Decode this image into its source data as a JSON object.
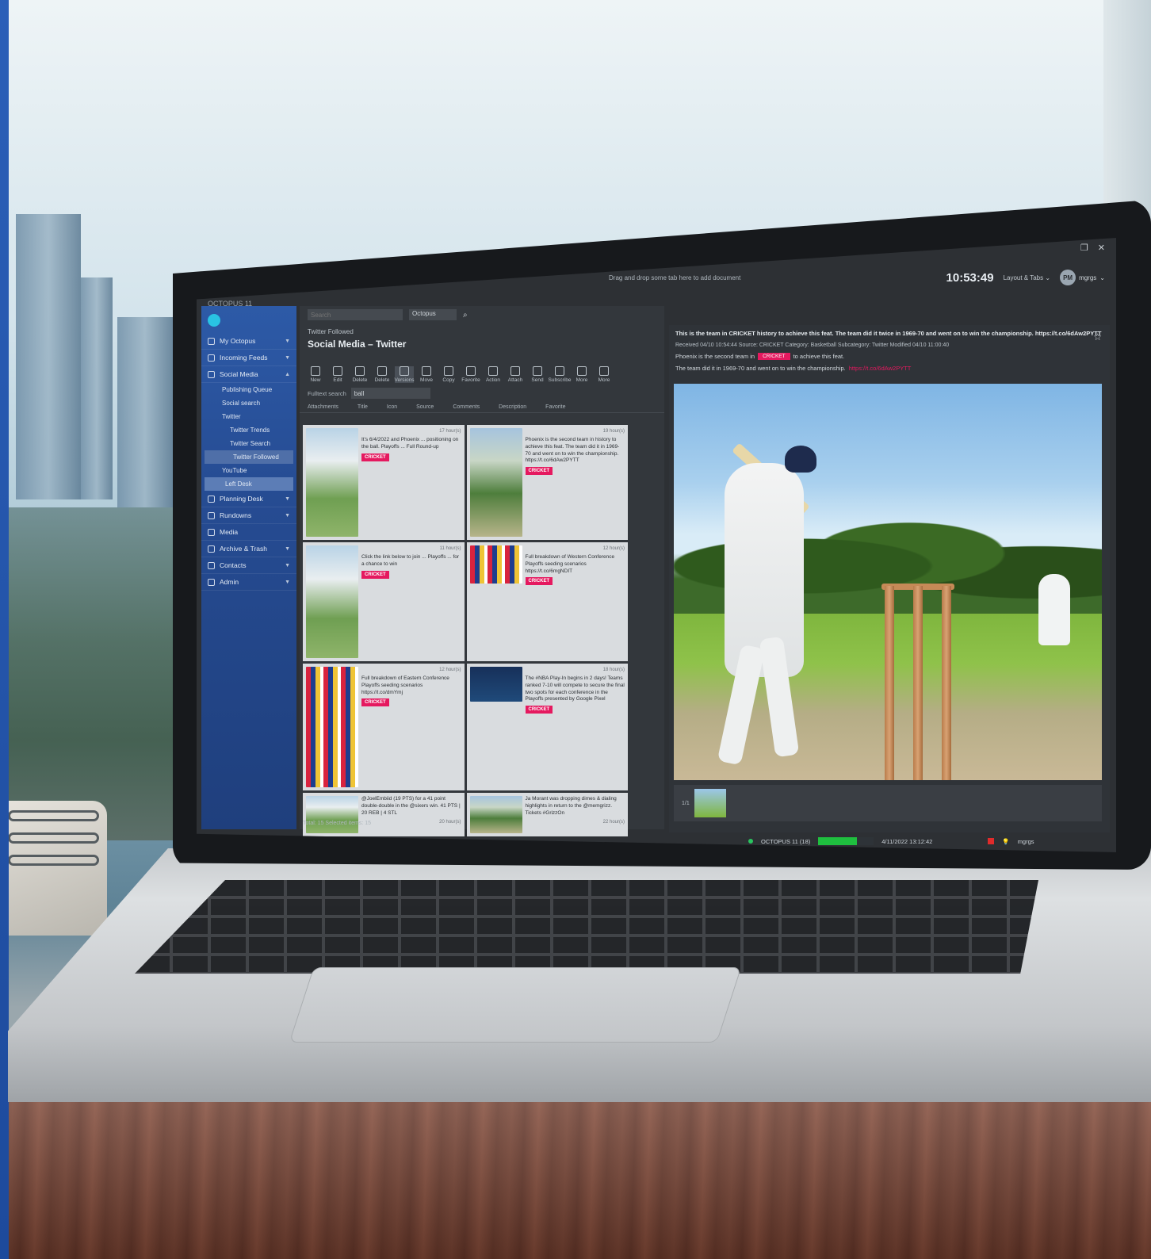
{
  "app": {
    "title": "OCTOPUS 11"
  },
  "topbar": {
    "drag_hint": "Drag and drop some tab here to add document",
    "clock": "10:53:49",
    "layout_label": "Layout & Tabs",
    "user_initials": "PM",
    "user_name": "mgrgs"
  },
  "sidebar": {
    "items": [
      {
        "label": "My Octopus"
      },
      {
        "label": "Incoming Feeds"
      },
      {
        "label": "Social Media"
      },
      {
        "label": "Publishing Queue"
      },
      {
        "label": "Social search"
      },
      {
        "label": "Twitter"
      },
      {
        "label": "Twitter Trends"
      },
      {
        "label": "Twitter Search"
      },
      {
        "label": "Twitter Followed"
      },
      {
        "label": "YouTube"
      },
      {
        "label": "Left Desk"
      },
      {
        "label": "Planning Desk"
      },
      {
        "label": "Rundowns"
      },
      {
        "label": "Media"
      },
      {
        "label": "Archive & Trash"
      },
      {
        "label": "Contacts"
      },
      {
        "label": "Admin"
      }
    ]
  },
  "list": {
    "search_placeholder": "Search",
    "select_value": "Octopus",
    "breadcrumb": "Twitter Followed",
    "title": "Social Media – Twitter",
    "toolbar": [
      "New",
      "Edit",
      "Delete",
      "Delete",
      "Versions",
      "Move",
      "Copy",
      "Favorite",
      "Action",
      "Attach",
      "Send",
      "Subscribe",
      "More",
      "More"
    ],
    "filter_label": "Fulltext search",
    "filter_value": "ball",
    "columns": [
      "Attachments",
      "Title",
      "Icon",
      "Source",
      "Comments",
      "Description",
      "Favorite"
    ],
    "status": "Total: 15  Selected items: 15",
    "cards": [
      {
        "text": "It's 6/4/2022 and Phoenix ... positioning on the ball. Playoffs ... Full Round-up",
        "tag": "CRICKET",
        "meta": "17 hour(s)"
      },
      {
        "text": "Phoenix is the second team in history to achieve this feat. The team did it in 1969-70 and went on to win the championship. https://t.co/6dAw2PYTT",
        "tag": "CRICKET",
        "meta": "19 hour(s)"
      },
      {
        "text": "Click the link below to join ... Playoffs ... for a chance to win",
        "tag": "CRICKET",
        "meta": "11 hour(s)"
      },
      {
        "text": "Full breakdown of Western Conference Playoffs seeding scenarios https://t.co/6mgNDIT",
        "tag": "CRICKET",
        "meta": "12 hour(s)"
      },
      {
        "text": "Full breakdown of Eastern Conference Playoffs seeding scenarios https://t.co/dmYmj",
        "tag": "CRICKET",
        "meta": "12 hour(s)"
      },
      {
        "text": "The #NBA Play-In begins in 2 days! Teams ranked 7-10 will compete to secure the final two spots for each conference in the Playoffs presented by Google Pixel",
        "tag": "CRICKET",
        "meta": "18 hour(s)"
      },
      {
        "text": "@JoelEmbiid (19 PTS) for a 41 point double-double in the @sixers win. 41 PTS | 20 REB | 4 STL",
        "tag": "",
        "meta": "20 hour(s)"
      },
      {
        "text": "Ja Morant was dropping dimes & dialing highlights in return to the @memgrizz. Tickets #GrizzOn",
        "tag": "",
        "meta": "22 hour(s)"
      }
    ]
  },
  "preview": {
    "headline": "This is the team in CRICKET history to achieve this feat. The team did it twice in 1969-70 and went on to win the championship. https://t.co/6dAw2PYTT",
    "meta": "Received 04/10 10:54:44  Source: CRICKET  Category: Basketball  Subcategory: Twitter  Modified 04/10 11:00:40",
    "line1_a": "Phoenix is the second team in",
    "line1_pill": "CRICKET",
    "line1_b": "to achieve this feat.",
    "line2": "The team did it in 1969-70 and went on to win the championship.",
    "line2_link": "https://t.co/6dAw2PYTT",
    "film_count": "1/1"
  },
  "statusbar": {
    "server": "OCTOPUS 11 (18)",
    "datetime": "4/11/2022 13:12:42",
    "user": "mgrgs"
  }
}
